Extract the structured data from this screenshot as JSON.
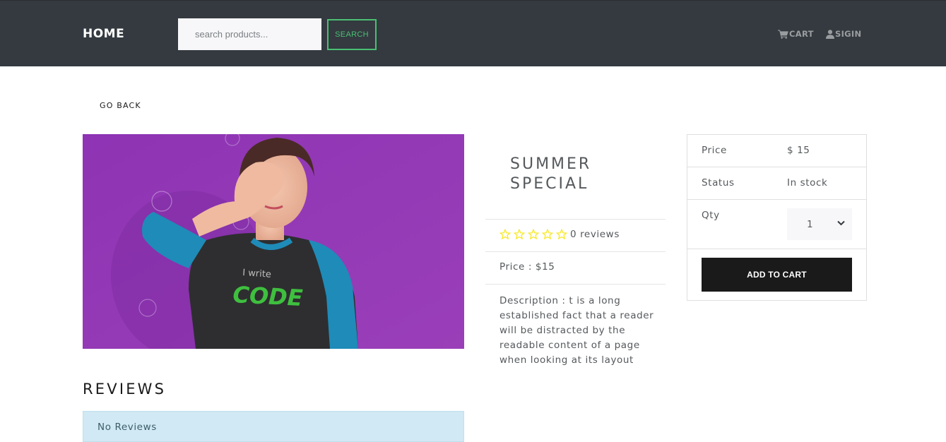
{
  "header": {
    "brand": "HOME",
    "search": {
      "placeholder": "search products...",
      "button_label": "SEARCH"
    },
    "cart_label": "CART",
    "signin_label": "SIGIN"
  },
  "nav": {
    "go_back_label": "GO BACK"
  },
  "product": {
    "image_alt": "I write CODE t-shirt",
    "shirt_text_small": "I write",
    "shirt_text_large": "CODE",
    "title_line1": "SUMMER",
    "title_line2": "SPECIAL",
    "rating": 0,
    "reviews_text": "0 reviews",
    "price_text": "Price : $15",
    "description": "Description : t is a long established fact that a reader will be distracted by the readable content of a page when looking at its layout"
  },
  "purchase_card": {
    "price_label": "Price",
    "price_value": "$ 15",
    "status_label": "Status",
    "status_value": "In stock",
    "qty_label": "Qty",
    "qty_value": "1",
    "add_to_cart_label": "ADD TO CART"
  },
  "reviews": {
    "heading": "REVIEWS",
    "empty_message": "No Reviews"
  },
  "colors": {
    "navbar": "#343a40",
    "accent_green": "#4bbf73",
    "star": "#f8e825",
    "alert_bg": "#d1e9f4",
    "button_dark": "#1a1a1a"
  }
}
